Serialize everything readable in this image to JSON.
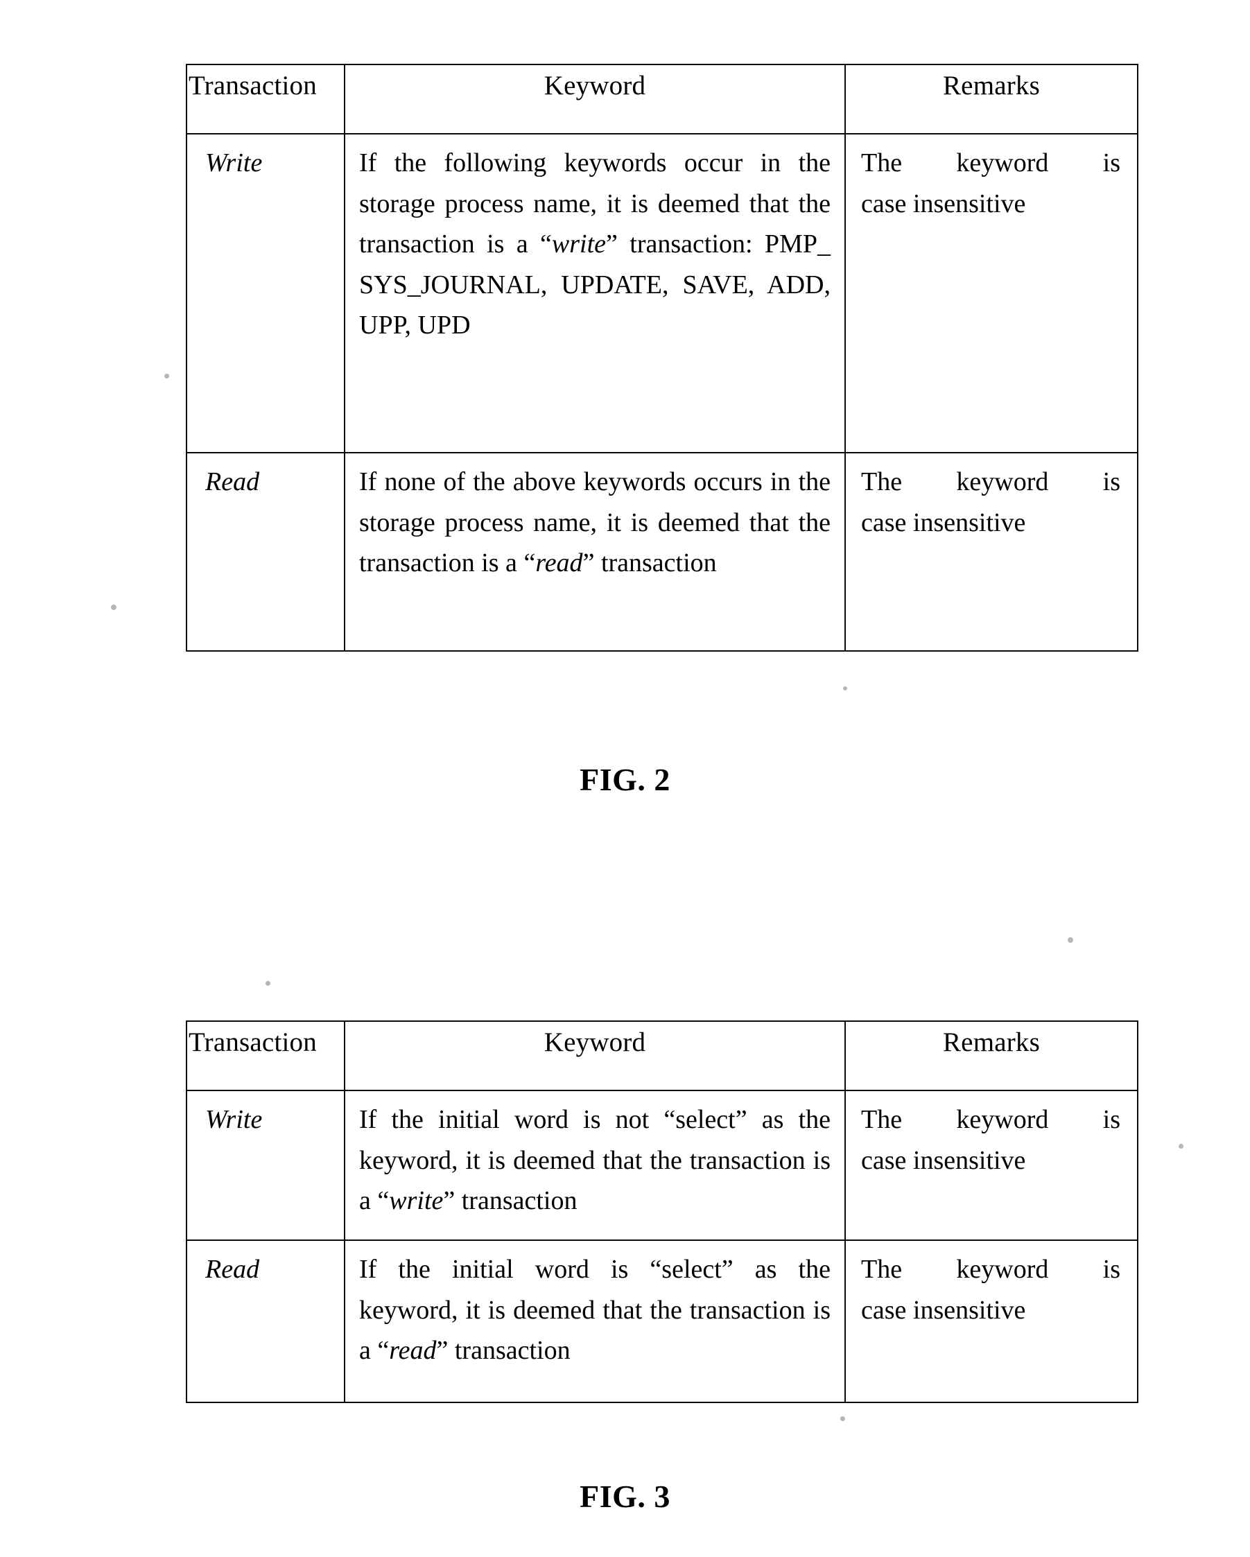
{
  "document": {
    "type": "patent-drawing-sheet",
    "columns": [
      "Transaction",
      "Keyword",
      "Remarks"
    ]
  },
  "figure2": {
    "caption": "FIG. 2",
    "headers": {
      "transaction": "Transaction",
      "keyword": "Keyword",
      "remarks": "Remarks"
    },
    "rows": [
      {
        "transaction": "Write",
        "keyword_prefix": "If the following keywords occur in the storage process name, it is deemed that the transaction is a ",
        "keyword_quoted": "write",
        "keyword_suffix": " transaction: PMP_ SYS_JOURNAL, UPDATE, SAVE, ADD, UPP, UPD",
        "remarks_line1": "The keyword is",
        "remarks_line2": "case insensitive"
      },
      {
        "transaction": "Read",
        "keyword_prefix": "If none of the above keywords occurs in the storage process name, it is deemed that the transaction is a ",
        "keyword_quoted": "read",
        "keyword_suffix": " transaction",
        "remarks_line1": "The keyword is",
        "remarks_line2": "case insensitive"
      }
    ]
  },
  "figure3": {
    "caption": "FIG. 3",
    "headers": {
      "transaction": "Transaction",
      "keyword": "Keyword",
      "remarks": "Remarks"
    },
    "rows": [
      {
        "transaction": "Write",
        "keyword_prefix": "If the initial word is not “select” as the keyword, it is deemed that the transaction is a ",
        "keyword_quoted": "write",
        "keyword_suffix": " transaction",
        "remarks_line1": "The keyword is",
        "remarks_line2": "case insensitive"
      },
      {
        "transaction": "Read",
        "keyword_prefix": "If the initial word is “select” as the keyword, it is deemed that the transaction is a ",
        "keyword_quoted": "read",
        "keyword_suffix": " transaction",
        "remarks_line1": "The keyword is",
        "remarks_line2": "case insensitive"
      }
    ]
  },
  "punctuation": {
    "open_quote": "“",
    "close_quote": "”"
  }
}
